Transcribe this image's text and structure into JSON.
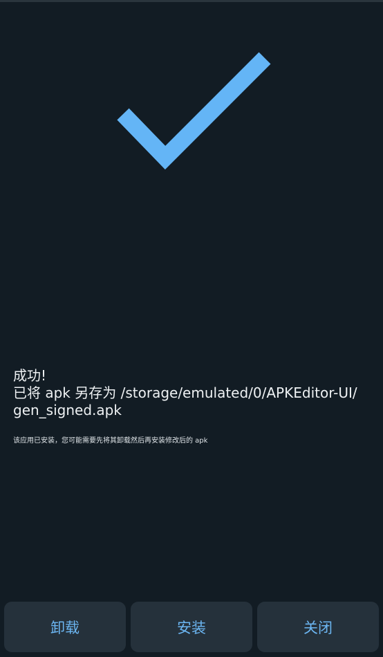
{
  "status": {
    "title": "成功!",
    "line1": "已将 apk 另存为 /storage/emulated/0/APKEditor-UI/",
    "line2": "gen_signed.apk"
  },
  "note": "该应用已安装，您可能需要先将其卸载然后再安装修改后的 apk",
  "buttons": {
    "uninstall": "卸载",
    "install": "安装",
    "close": "关闭"
  },
  "colors": {
    "background": "#121c24",
    "accent": "#6cb6f2",
    "checkmark": "#64b5f6",
    "button_bg": "#25313b"
  },
  "icon": "checkmark-icon"
}
